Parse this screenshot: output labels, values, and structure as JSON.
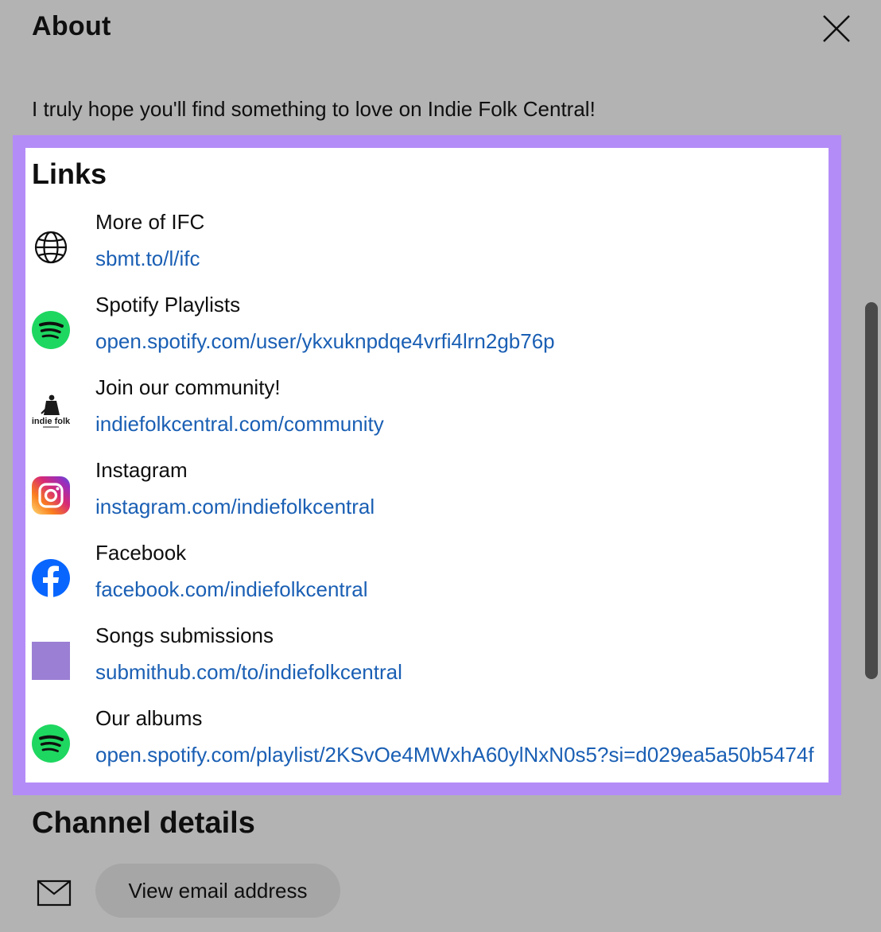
{
  "header": {
    "title": "About",
    "close_icon": "close-icon"
  },
  "description": "I truly hope you'll find something to love on Indie Folk Central!",
  "links": {
    "heading": "Links",
    "items": [
      {
        "title": "More of IFC",
        "url": "sbmt.to/l/ifc",
        "icon": "globe-icon"
      },
      {
        "title": "Spotify Playlists",
        "url": "open.spotify.com/user/ykxuknpdqe4vrfi4lrn2gb76p",
        "icon": "spotify-icon"
      },
      {
        "title": "Join our community!",
        "url": "indiefolkcentral.com/community",
        "icon": "indie-folk-logo-icon",
        "icon_text": "indie folk"
      },
      {
        "title": "Instagram",
        "url": "instagram.com/indiefolkcentral",
        "icon": "instagram-icon"
      },
      {
        "title": "Facebook",
        "url": "facebook.com/indiefolkcentral",
        "icon": "facebook-icon"
      },
      {
        "title": "Songs submissions",
        "url": "submithub.com/to/indiefolkcentral",
        "icon": "purple-square-icon"
      },
      {
        "title": "Our albums",
        "url": "open.spotify.com/playlist/2KSvOe4MWxhA60ylNxN0s5?si=d029ea5a50b5474f",
        "icon": "spotify-icon"
      }
    ]
  },
  "channel_details": {
    "heading": "Channel details",
    "view_email_label": "View email address",
    "mail_icon": "mail-icon"
  },
  "colors": {
    "highlight": "#b38cf7",
    "link": "#1a5fb4",
    "spotify": "#1ed760",
    "facebook": "#0866ff",
    "submithub": "#9b7fd4"
  }
}
